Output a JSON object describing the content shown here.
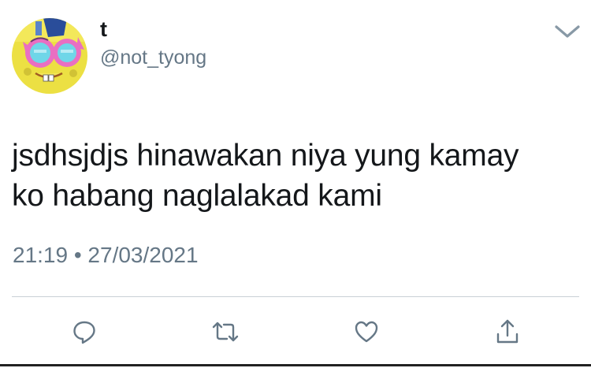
{
  "tweet": {
    "display_name": "t",
    "handle": "@not_tyong",
    "text_lines": [
      "jsdhsjdjs hinawakan niya yung kamay",
      "ko habang naglalakad kami"
    ],
    "timestamp": "21:19 • 27/03/2021"
  },
  "actions": [
    {
      "name": "reply",
      "icon": "speech-bubble-icon"
    },
    {
      "name": "retweet",
      "icon": "retweet-arrows-icon"
    },
    {
      "name": "like",
      "icon": "heart-icon"
    },
    {
      "name": "share",
      "icon": "share-upload-icon"
    }
  ],
  "colors": {
    "text_primary": "#14171a",
    "text_secondary": "#657786",
    "icon": "#657786",
    "divider": "#c9d0d6"
  }
}
